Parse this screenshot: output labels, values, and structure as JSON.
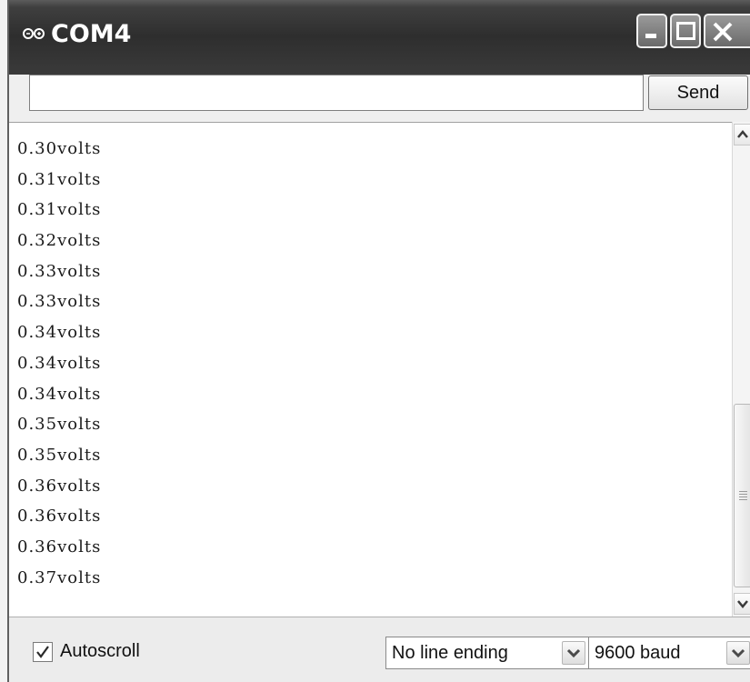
{
  "window": {
    "title": "COM4",
    "icon": "arduino-infinity-icon"
  },
  "toolbar": {
    "input_value": "",
    "send_label": "Send"
  },
  "serial_output": {
    "lines": [
      "0.30volts",
      "0.31volts",
      "0.31volts",
      "0.32volts",
      "0.33volts",
      "0.33volts",
      "0.34volts",
      "0.34volts",
      "0.34volts",
      "0.35volts",
      "0.35volts",
      "0.36volts",
      "0.36volts",
      "0.36volts",
      "0.37volts"
    ]
  },
  "footer": {
    "autoscroll_label": "Autoscroll",
    "autoscroll_checked": true,
    "line_ending": "No line ending",
    "baud_rate": "9600 baud"
  }
}
